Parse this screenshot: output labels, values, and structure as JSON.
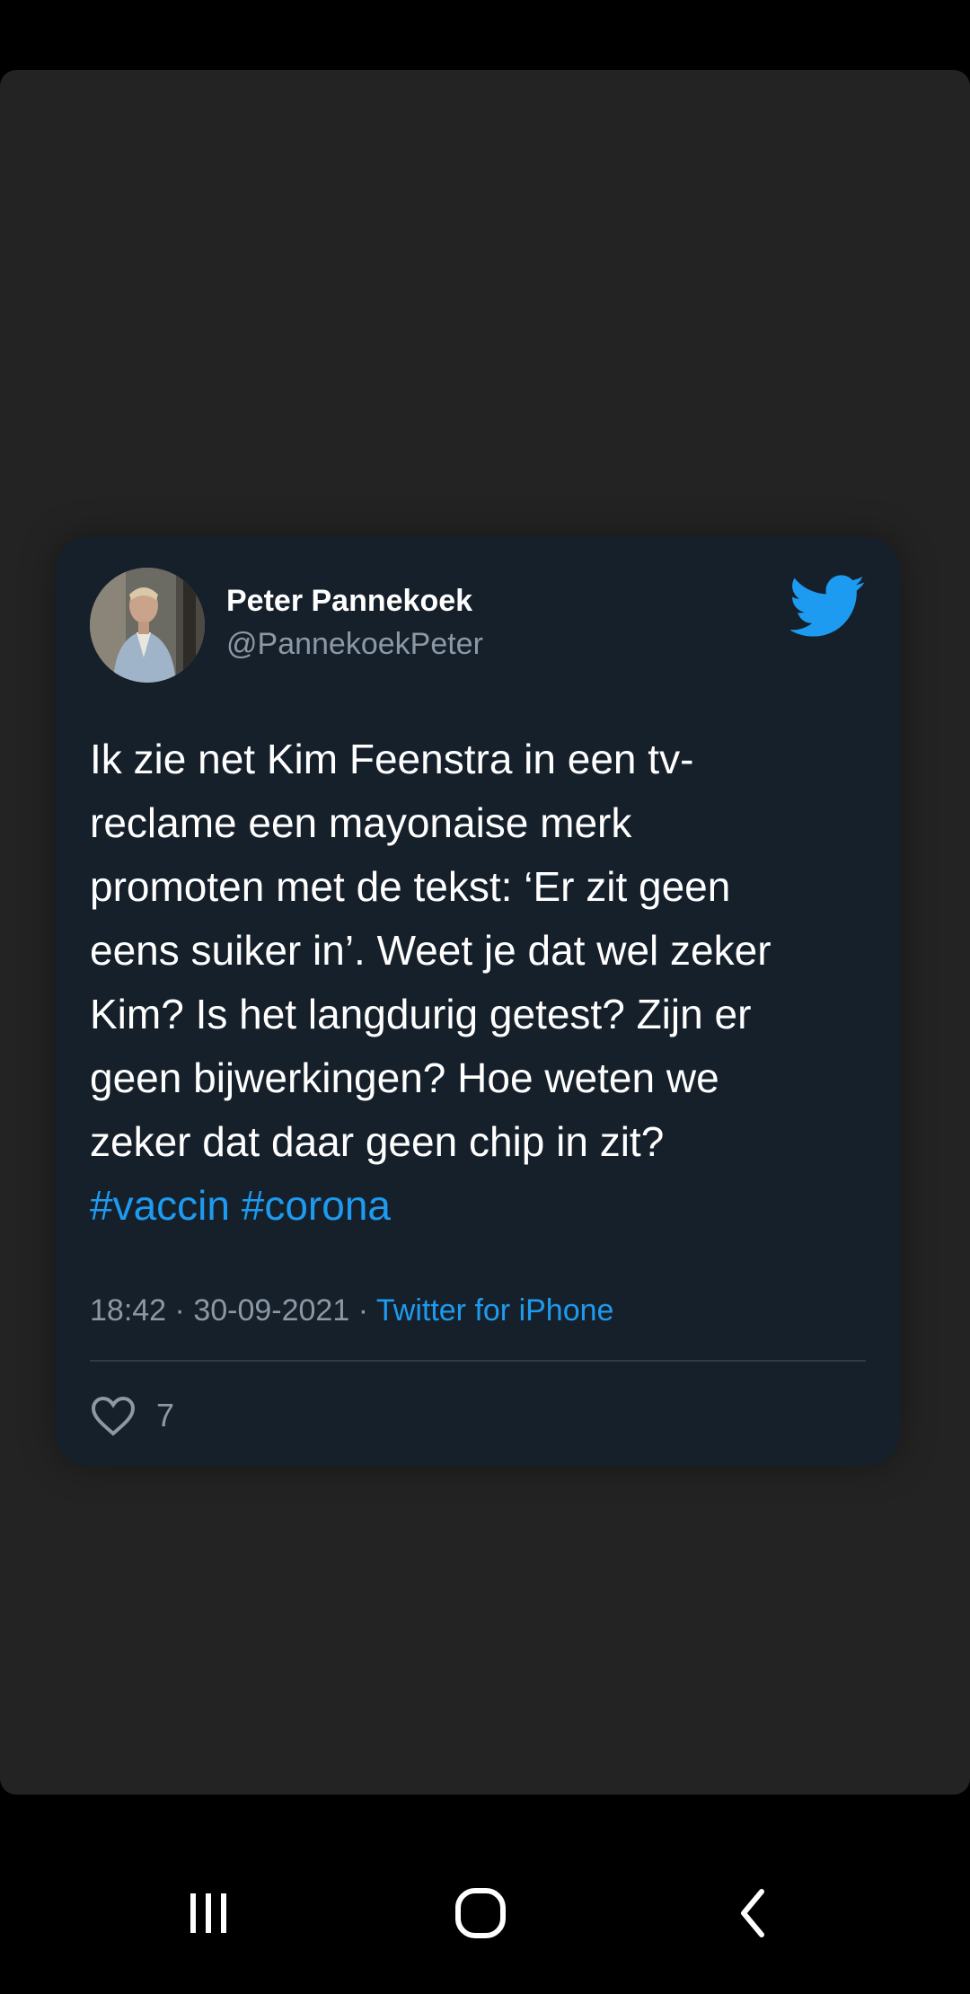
{
  "tweet": {
    "author_name": "Peter Pannekoek",
    "author_handle": "@PannekoekPeter",
    "text_lines": [
      "Ik zie net Kim Feenstra in een tv-",
      "reclame een mayonaise merk",
      "promoten met de tekst: ‘Er zit geen",
      "eens suiker in’. Weet je dat wel zeker",
      "Kim? Is het langdurig getest? Zijn er",
      "geen bijwerkingen? Hoe weten we",
      "zeker dat daar geen chip in zit?"
    ],
    "hashtags": [
      "#vaccin",
      "#corona"
    ],
    "time": "18:42",
    "date": "30-09-2021",
    "separator": "·",
    "source": "Twitter for iPhone",
    "like_count": "7",
    "brand_icon": "twitter-bird-icon",
    "like_icon": "heart-outline-icon"
  },
  "navbar": {
    "recents_icon": "recent-apps-icon",
    "home_icon": "home-icon",
    "back_icon": "back-chevron-icon"
  },
  "colors": {
    "background": "#000000",
    "viewer_background": "#232323",
    "card_background": "#16202a",
    "primary_text": "#ffffff",
    "secondary_text": "#8b98a5",
    "accent_blue": "#1d9bf0"
  }
}
